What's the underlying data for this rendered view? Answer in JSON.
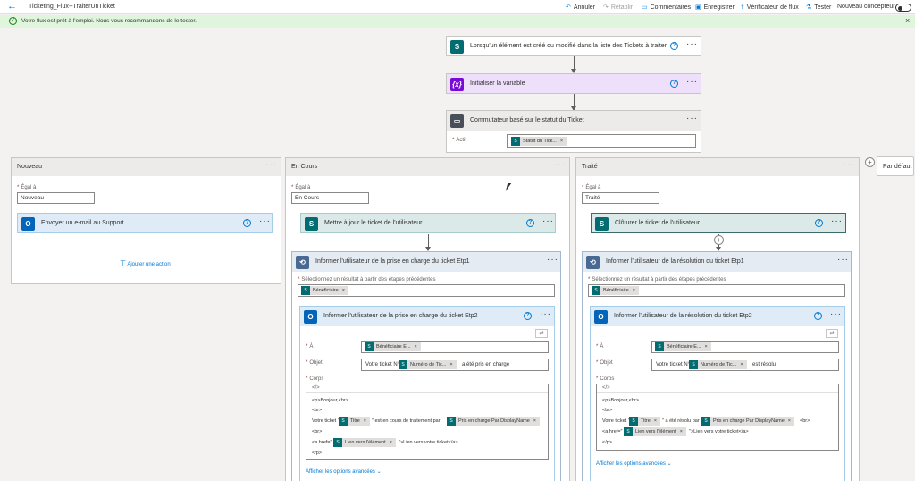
{
  "topbar": {
    "back_icon": "arrow-left-icon",
    "flow_name": "Ticketing_Flux--TraiterUnTicket",
    "undo": "Annuler",
    "redo": "Rétablir",
    "comments": "Commentaires",
    "save": "Enregistrer",
    "checker": "Vérificateur de flux",
    "test": "Tester",
    "new_designer": "Nouveau concepteur"
  },
  "notice": {
    "message": "Votre flux est prêt à l'emploi. Nous vous recommandons de le tester.",
    "close": "×"
  },
  "trigger": {
    "title": "Lorsqu'un élément est créé ou modifié dans la liste des Tickets à traiter"
  },
  "init_var": {
    "title": "Initialiser la variable"
  },
  "switch": {
    "title": "Commutateur basé sur le statut du Ticket",
    "on_label": "Actif",
    "on_token": "Statut du Tick..."
  },
  "cases": {
    "nouveau": {
      "title": "Nouveau",
      "equals_label": "Égal à",
      "equals_value": "Nouveau",
      "action_title": "Envoyer un e-mail au Support",
      "add_action": "Ajouter une action"
    },
    "encours": {
      "title": "En Cours",
      "equals_label": "Égal à",
      "equals_value": "En Cours",
      "update_title": "Mettre à jour le ticket de l'utilisateur",
      "loop_title": "Informer l'utilisateur de la prise en charge du ticket Etp1",
      "loop_select_label": "Sélectionnez un résultat à partir des étapes précédentes",
      "loop_token": "Bénéficiaire",
      "mail_title": "Informer l'utilisateur de la prise en charge du ticket Etp2",
      "to_label": "À",
      "to_token": "Bénéficiaire E...",
      "subject_label": "Objet",
      "subject_prefix": "Votre ticket N°",
      "subject_token": "Numéro de Tic...",
      "subject_suffix": "a été pris en charge",
      "body_label": "Corps",
      "body_line1": "<p>Bonjour,<br>",
      "body_line2": "<br>",
      "body_line3_prefix": "Votre ticket \"",
      "body_token_title": "Titre",
      "body_line3_mid": "\" est en cours de traitement par",
      "body_token_owner": "Pris en charge Par DisplayName",
      "body_line4": "<br>",
      "body_line5_prefix": "<a href=\"",
      "body_token_link": "Lien vers l'élément",
      "body_line5_suffix": "\">Lien vers votre ticket</a>",
      "body_line6": "</p>",
      "advanced": "Afficher les options avancées"
    },
    "traite": {
      "title": "Traité",
      "equals_label": "Égal à",
      "equals_value": "Traité",
      "close_title": "Clôturer le ticket de l'utilisateur",
      "loop_title": "Informer l'utilisateur de la résolution du ticket Etp1",
      "loop_select_label": "Sélectionnez un résultat à partir des étapes précédentes",
      "loop_token": "Bénéficiaire",
      "mail_title": "Informer l'utilisateur de la résolution du ticket Etp2",
      "to_label": "À",
      "to_token": "Bénéficiaire E...",
      "subject_label": "Objet",
      "subject_prefix": "Votre ticket N°",
      "subject_token": "Numéro de Tic...",
      "subject_suffix": "est résolu",
      "body_label": "Corps",
      "body_line1": "<p>Bonjour,<br>",
      "body_line2": "<br>",
      "body_line3_prefix": "Votre ticket \"",
      "body_token_title": "Titre",
      "body_line3_mid": "\" a été résolu par",
      "body_token_owner": "Pris en charge Par DisplayName",
      "body_line3_suffix": "<br>",
      "body_line4_prefix": "<a href=\"",
      "body_token_link": "Lien vers l'élément",
      "body_line4_suffix": "\">Lien vers votre ticket</a>",
      "body_line5": "</p>",
      "advanced": "Afficher les options avancées"
    },
    "default": {
      "title": "Par défaut"
    }
  },
  "colors": {
    "accent": "#0078d4",
    "sharepoint": "#036c70",
    "variable": "#770bd6",
    "outlook": "#0364b8",
    "loop": "#486991",
    "success_bg": "#dff6dd"
  }
}
